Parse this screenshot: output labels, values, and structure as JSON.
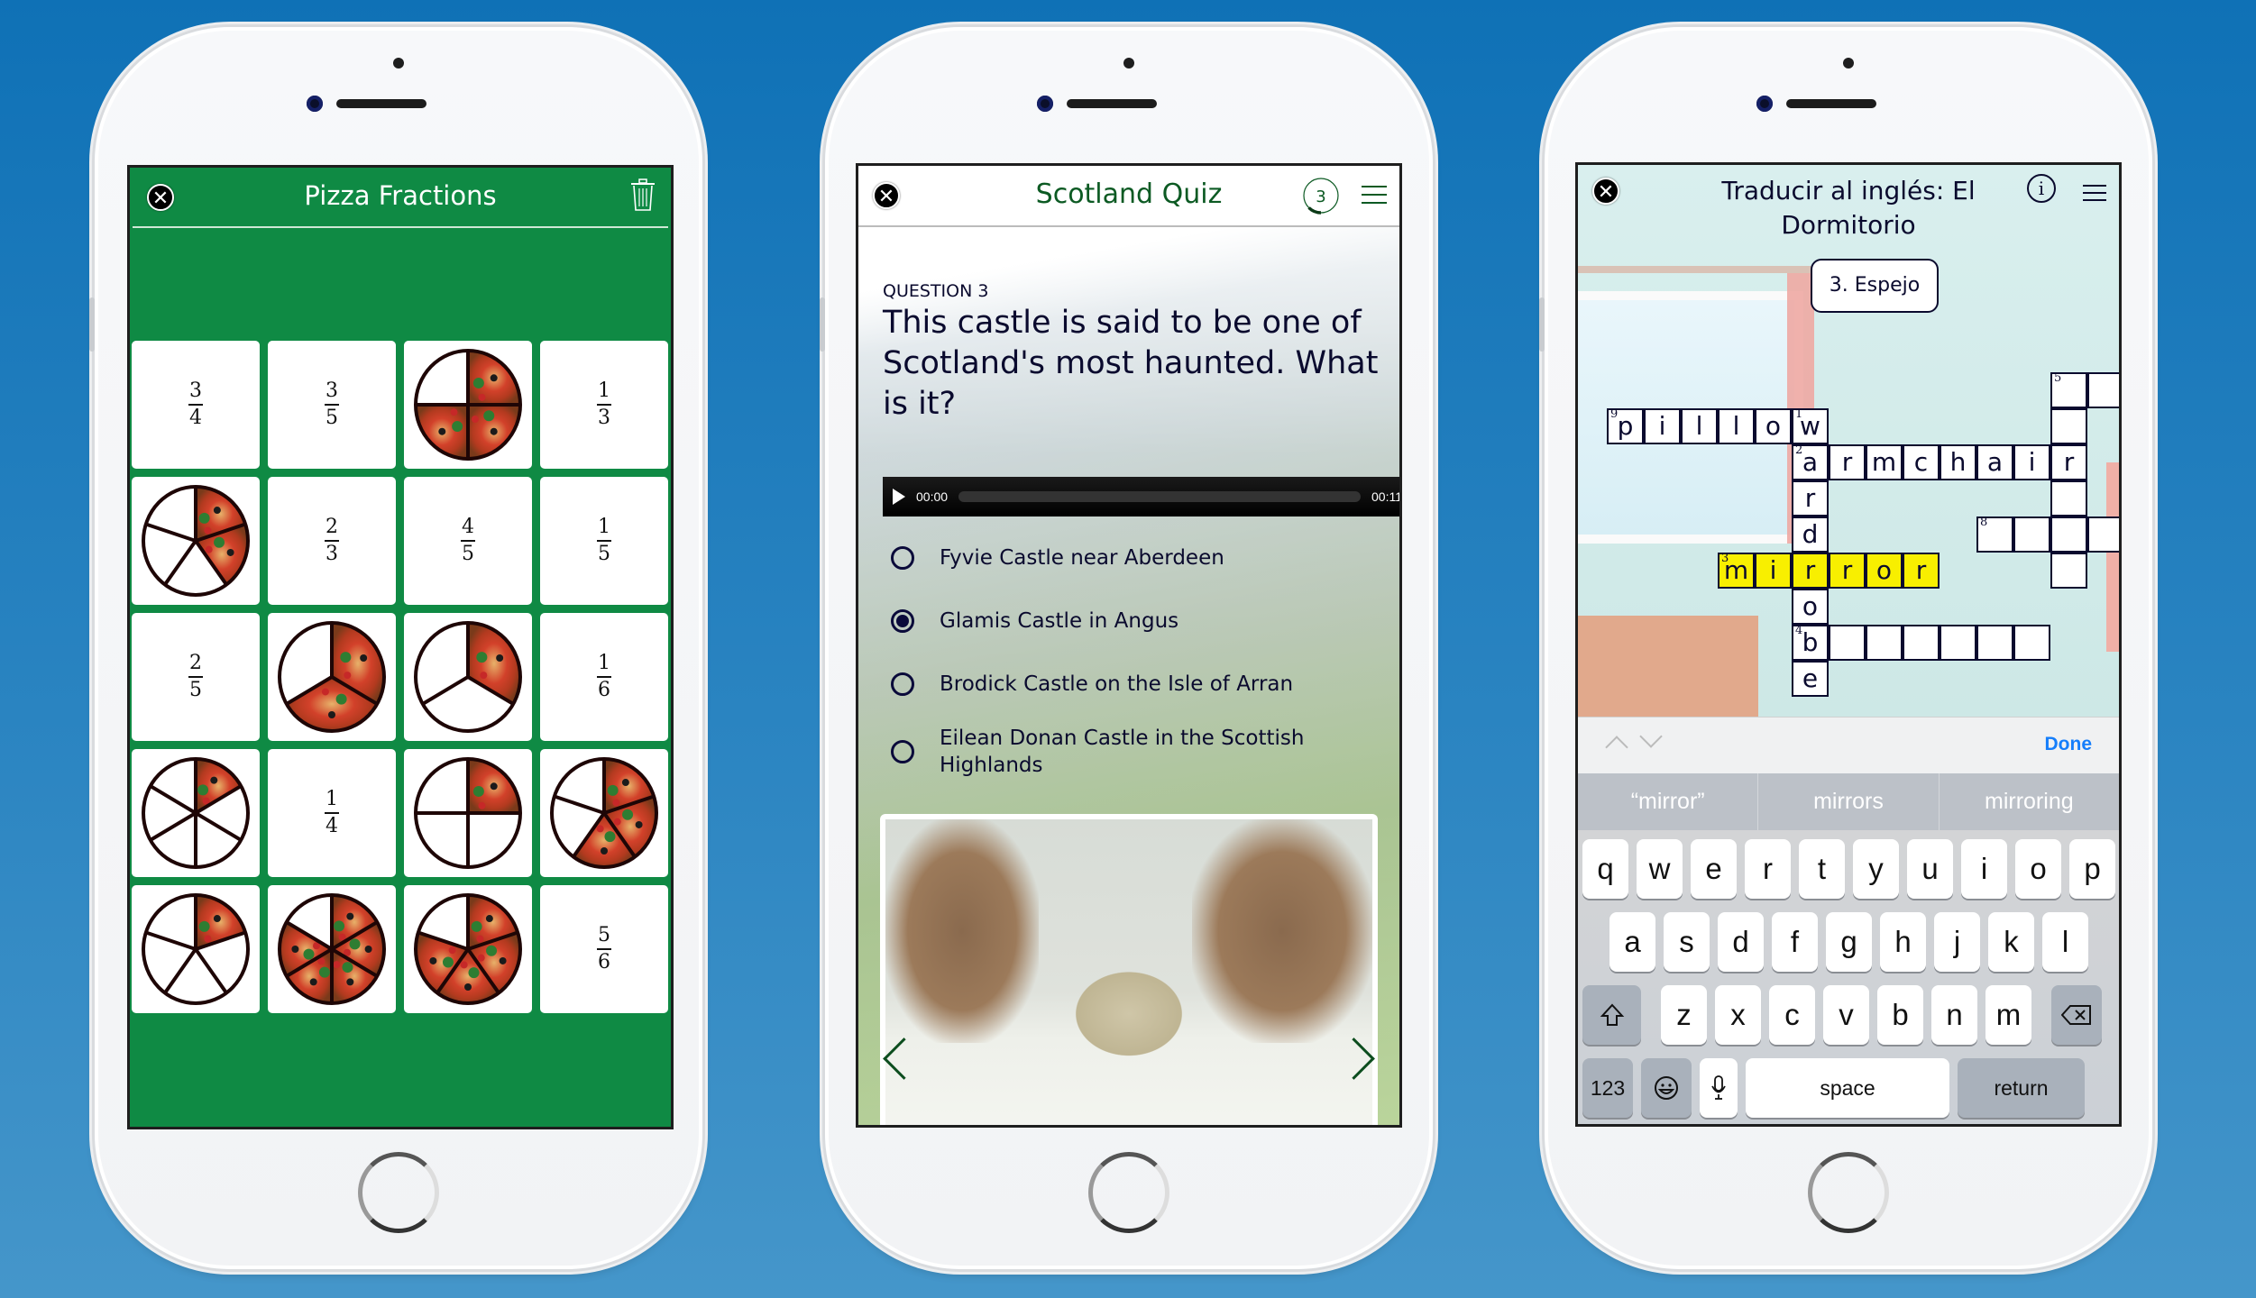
{
  "phones": {
    "pizza": {
      "title": "Pizza Fractions",
      "close_icon": "close-icon",
      "trash_icon": "trash-icon",
      "accent": "#0f8a44",
      "cards": [
        {
          "type": "fraction",
          "num": "3",
          "den": "4"
        },
        {
          "type": "fraction",
          "num": "3",
          "den": "5"
        },
        {
          "type": "pizza",
          "slices": 4,
          "filled": 3
        },
        {
          "type": "fraction",
          "num": "1",
          "den": "3"
        },
        {
          "type": "pizza",
          "slices": 5,
          "filled": 2
        },
        {
          "type": "fraction",
          "num": "2",
          "den": "3"
        },
        {
          "type": "fraction",
          "num": "4",
          "den": "5"
        },
        {
          "type": "fraction",
          "num": "1",
          "den": "5"
        },
        {
          "type": "fraction",
          "num": "2",
          "den": "5"
        },
        {
          "type": "pizza",
          "slices": 3,
          "filled": 2
        },
        {
          "type": "pizza",
          "slices": 3,
          "filled": 1
        },
        {
          "type": "fraction",
          "num": "1",
          "den": "6"
        },
        {
          "type": "pizza",
          "slices": 6,
          "filled": 1
        },
        {
          "type": "fraction",
          "num": "1",
          "den": "4"
        },
        {
          "type": "pizza",
          "slices": 4,
          "filled": 1
        },
        {
          "type": "pizza",
          "slices": 5,
          "filled": 3
        },
        {
          "type": "pizza",
          "slices": 5,
          "filled": 1
        },
        {
          "type": "pizza",
          "slices": 6,
          "filled": 5
        },
        {
          "type": "pizza",
          "slices": 5,
          "filled": 4
        },
        {
          "type": "fraction",
          "num": "5",
          "den": "6"
        }
      ]
    },
    "quiz": {
      "title": "Scotland Quiz",
      "progress_number": "3",
      "progress_fraction": 0.3,
      "question_label": "QUESTION 3",
      "question": "This castle is said to be one of Scotland's most haunted. What is it?",
      "audio": {
        "current": "00:00",
        "duration": "00:11",
        "progress": 0
      },
      "options": [
        {
          "label": "Fyvie Castle near Aberdeen",
          "selected": false
        },
        {
          "label": "Glamis Castle in Angus",
          "selected": true
        },
        {
          "label": "Brodick Castle on the Isle of Arran",
          "selected": false
        },
        {
          "label": "Eilean Donan Castle in the Scottish Highlands",
          "selected": false
        }
      ],
      "accent": "#0c5a23"
    },
    "crossword": {
      "title": "Traducir al inglés: El Dormitorio",
      "info_icon": "i",
      "clue": "3. Espejo",
      "cells": [
        {
          "r": 0,
          "c": 12,
          "n": "5",
          "v": ""
        },
        {
          "r": 0,
          "c": 13,
          "v": ""
        },
        {
          "r": 1,
          "c": 0,
          "n": "9",
          "v": "p"
        },
        {
          "r": 1,
          "c": 1,
          "v": "i"
        },
        {
          "r": 1,
          "c": 2,
          "v": "l"
        },
        {
          "r": 1,
          "c": 3,
          "v": "l"
        },
        {
          "r": 1,
          "c": 4,
          "v": "o"
        },
        {
          "r": 1,
          "c": 5,
          "n": "1",
          "v": "w"
        },
        {
          "r": 1,
          "c": 12,
          "v": ""
        },
        {
          "r": 2,
          "c": 5,
          "n": "2",
          "v": "a"
        },
        {
          "r": 2,
          "c": 6,
          "v": "r"
        },
        {
          "r": 2,
          "c": 7,
          "v": "m"
        },
        {
          "r": 2,
          "c": 8,
          "v": "c"
        },
        {
          "r": 2,
          "c": 9,
          "v": "h"
        },
        {
          "r": 2,
          "c": 10,
          "v": "a"
        },
        {
          "r": 2,
          "c": 11,
          "v": "i"
        },
        {
          "r": 2,
          "c": 12,
          "v": "r"
        },
        {
          "r": 3,
          "c": 5,
          "v": "r"
        },
        {
          "r": 3,
          "c": 12,
          "v": ""
        },
        {
          "r": 4,
          "c": 5,
          "v": "d"
        },
        {
          "r": 4,
          "c": 10,
          "n": "8",
          "v": ""
        },
        {
          "r": 4,
          "c": 11,
          "v": ""
        },
        {
          "r": 4,
          "c": 12,
          "v": ""
        },
        {
          "r": 4,
          "c": 13,
          "v": ""
        },
        {
          "r": 5,
          "c": 3,
          "n": "3",
          "v": "m",
          "hl": true
        },
        {
          "r": 5,
          "c": 4,
          "v": "i",
          "hl": true
        },
        {
          "r": 5,
          "c": 5,
          "v": "r",
          "hl": true
        },
        {
          "r": 5,
          "c": 6,
          "v": "r",
          "hl": true
        },
        {
          "r": 5,
          "c": 7,
          "v": "o",
          "hl": true
        },
        {
          "r": 5,
          "c": 8,
          "v": "r",
          "hl": true
        },
        {
          "r": 5,
          "c": 12,
          "v": ""
        },
        {
          "r": 6,
          "c": 5,
          "v": "o"
        },
        {
          "r": 7,
          "c": 5,
          "n": "4",
          "v": "b"
        },
        {
          "r": 7,
          "c": 6,
          "v": ""
        },
        {
          "r": 7,
          "c": 7,
          "v": ""
        },
        {
          "r": 7,
          "c": 8,
          "v": ""
        },
        {
          "r": 7,
          "c": 9,
          "v": ""
        },
        {
          "r": 7,
          "c": 10,
          "v": ""
        },
        {
          "r": 7,
          "c": 11,
          "v": ""
        },
        {
          "r": 8,
          "c": 5,
          "v": "e"
        }
      ],
      "highlight_color": "#f8ef00",
      "done_label": "Done",
      "suggestions": [
        "“mirror”",
        "mirrors",
        "mirroring"
      ],
      "keyboard": {
        "row1": [
          "q",
          "w",
          "e",
          "r",
          "t",
          "y",
          "u",
          "i",
          "o",
          "p"
        ],
        "row2": [
          "a",
          "s",
          "d",
          "f",
          "g",
          "h",
          "j",
          "k",
          "l"
        ],
        "row3": [
          "z",
          "x",
          "c",
          "v",
          "b",
          "n",
          "m"
        ],
        "numbers_label": "123",
        "space_label": "space",
        "return_label": "return"
      }
    }
  }
}
